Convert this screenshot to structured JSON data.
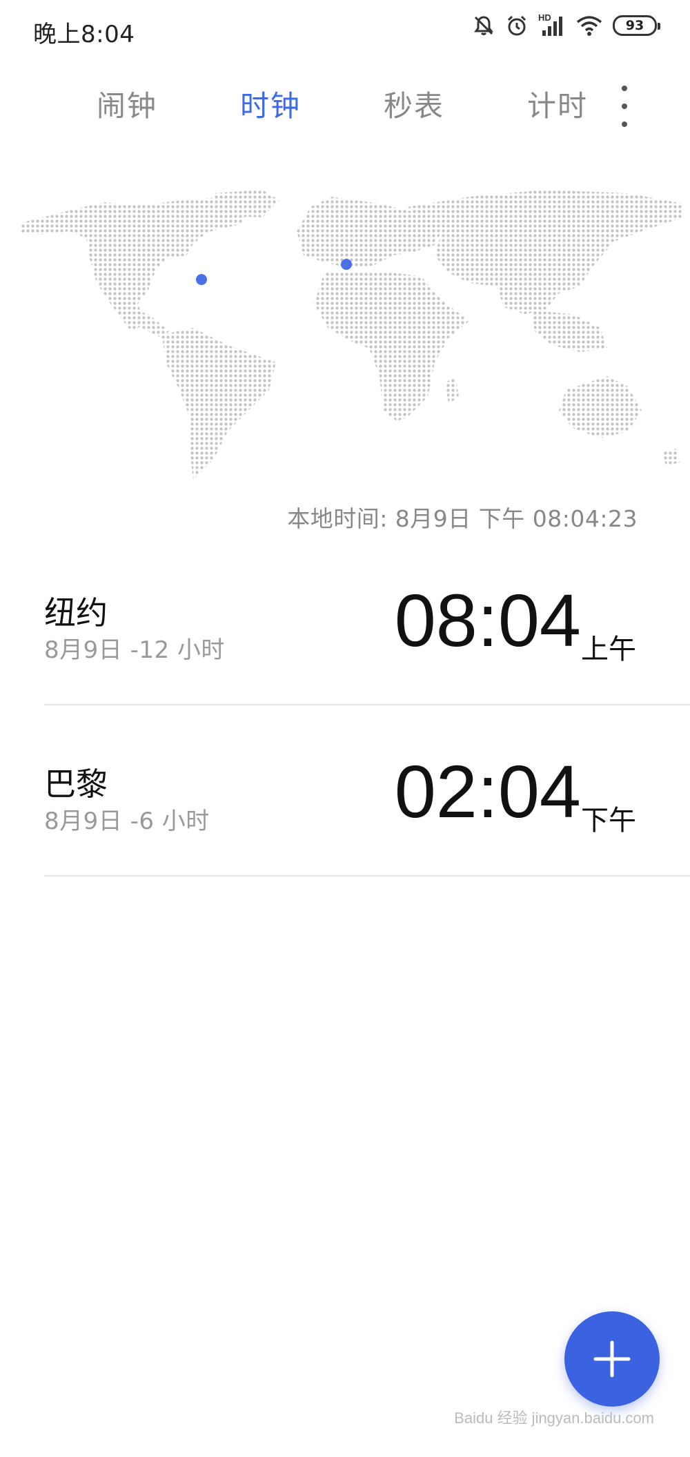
{
  "status_bar": {
    "time": "晚上8:04",
    "network_label": "HD",
    "battery": "93",
    "icons": [
      "mute-icon",
      "alarm-icon",
      "signal-icon",
      "wifi-icon",
      "battery-icon"
    ]
  },
  "tabs": [
    {
      "label": "闹钟",
      "active": false
    },
    {
      "label": "时钟",
      "active": true
    },
    {
      "label": "秒表",
      "active": false
    },
    {
      "label": "计时",
      "active": false
    }
  ],
  "colors": {
    "accent": "#3b6bea",
    "fab": "#3b62e0",
    "map_dot": "#c4c4c4",
    "map_marker": "#4a6fe8",
    "muted_text": "#888888"
  },
  "local_time": "本地时间: 8月9日  下午  08:04:23",
  "cities": [
    {
      "name": "纽约",
      "date_offset": "8月9日 -12 小时",
      "time": "08:04",
      "ampm": "上午"
    },
    {
      "name": "巴黎",
      "date_offset": "8月9日 -6 小时",
      "time": "02:04",
      "ampm": "下午"
    }
  ],
  "fab": {
    "icon": "plus-icon"
  },
  "watermark": "Baidu 经验 jingyan.baidu.com"
}
